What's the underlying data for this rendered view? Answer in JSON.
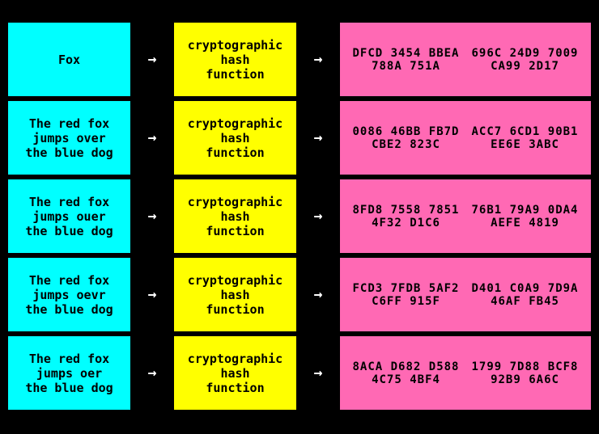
{
  "rows": [
    {
      "input": "Fox",
      "hash_label": "cryptographic\nhash\nfunction",
      "output_line1": "DFCD  3454  BBEA  788A  751A",
      "output_line2": "696C  24D9  7009  CA99  2D17"
    },
    {
      "input": "The red fox\njumps over\nthe blue dog",
      "hash_label": "cryptographic\nhash\nfunction",
      "output_line1": "0086  46BB  FB7D  CBE2  823C",
      "output_line2": "ACC7  6CD1  90B1  EE6E  3ABC"
    },
    {
      "input": "The red fox\njumps ouer\nthe blue dog",
      "hash_label": "cryptographic\nhash\nfunction",
      "output_line1": "8FD8  7558  7851  4F32  D1C6",
      "output_line2": "76B1  79A9  0DA4  AEFE  4819"
    },
    {
      "input": "The red fox\njumps oevr\nthe blue dog",
      "hash_label": "cryptographic\nhash\nfunction",
      "output_line1": "FCD3  7FDB  5AF2  C6FF  915F",
      "output_line2": "D401  C0A9  7D9A  46AF  FB45"
    },
    {
      "input": "The red fox\njumps oer\nthe blue dog",
      "hash_label": "cryptographic\nhash\nfunction",
      "output_line1": "8ACA  D682  D588  4C75  4BF4",
      "output_line2": "1799  7D88  BCF8  92B9  6A6C"
    }
  ],
  "arrow_symbol": "→",
  "colors": {
    "input_bg": "#00FFFF",
    "hash_bg": "#FFFF00",
    "output_bg": "#FF69B4",
    "border": "#000000",
    "bg": "#000000"
  }
}
